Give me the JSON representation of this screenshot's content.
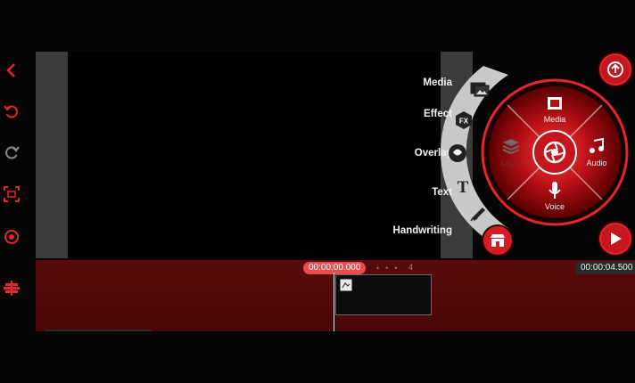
{
  "colors": {
    "accent": "#e2262b",
    "dark_red": "#4f0909",
    "panel": "#3b3b3b"
  },
  "toolbar": {
    "back_icon": "chevron-left-icon",
    "undo_icon": "undo-icon",
    "redo_icon": "redo-icon",
    "crop_icon": "fullscreen-crop-icon",
    "record_icon": "record-target-icon",
    "layers_icon": "layers-settings-icon"
  },
  "side_menu": {
    "items": [
      {
        "label": "Media",
        "icon": "image-icon"
      },
      {
        "label": "Effect",
        "icon": "fx-icon"
      },
      {
        "label": "Overlay",
        "icon": "sticker-icon"
      },
      {
        "label": "Text",
        "icon": "text-icon"
      },
      {
        "label": "Handwriting",
        "icon": "pen-icon"
      }
    ]
  },
  "wheel": {
    "media_label": "Media",
    "audio_label": "Audio",
    "voice_label": "Voice",
    "layer_label": "Layer"
  },
  "timeline": {
    "current_time": "00:00:00.000",
    "total_time": "00:00:04.500",
    "marker_label": "4"
  }
}
